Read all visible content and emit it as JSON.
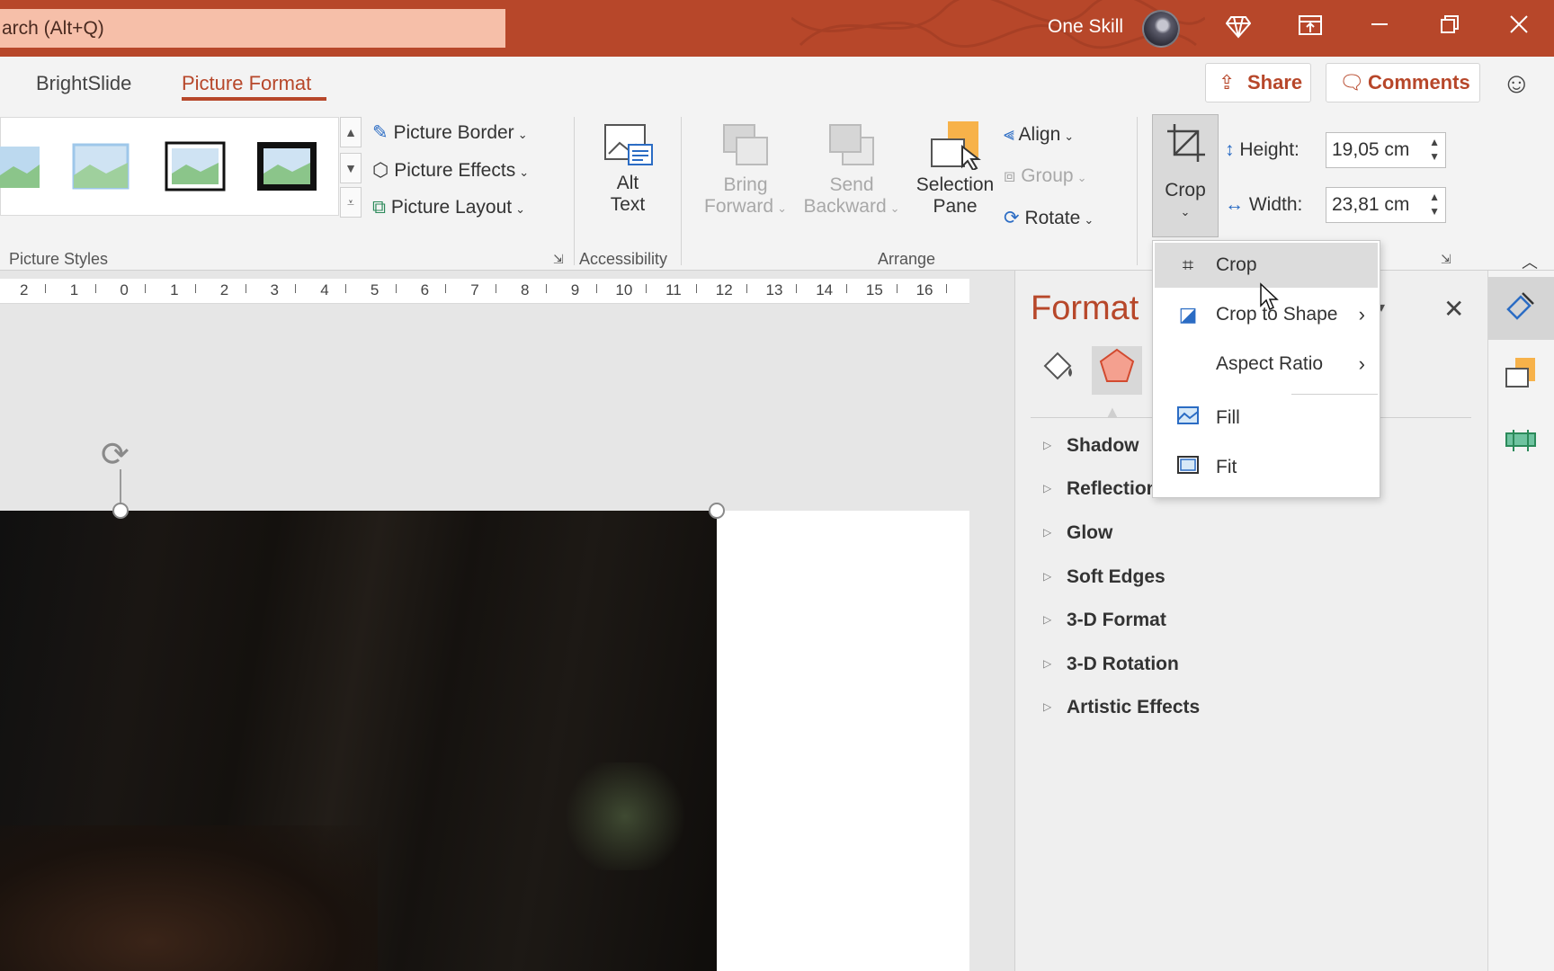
{
  "titlebar": {
    "search_text": "arch (Alt+Q)",
    "user_name": "One Skill",
    "accent": "#b7472a"
  },
  "tabs": {
    "brightslide": "BrightSlide",
    "picture_format": "Picture Format"
  },
  "actions": {
    "share": "Share",
    "comments": "Comments"
  },
  "ribbon": {
    "picture_styles": {
      "border": "Picture Border",
      "effects": "Picture Effects",
      "layout": "Picture Layout",
      "label": "Picture Styles"
    },
    "accessibility": {
      "alt_text_line1": "Alt",
      "alt_text_line2": "Text",
      "label": "Accessibility"
    },
    "arrange": {
      "bring_line1": "Bring",
      "bring_line2": "Forward",
      "send_line1": "Send",
      "send_line2": "Backward",
      "selection_line1": "Selection",
      "selection_line2": "Pane",
      "align": "Align",
      "group": "Group",
      "rotate": "Rotate",
      "label": "Arrange"
    },
    "size": {
      "crop": "Crop",
      "height_label": "Height:",
      "height_value": "19,05 cm",
      "width_label": "Width:",
      "width_value": "23,81 cm"
    }
  },
  "ruler": [
    "2",
    "1",
    "0",
    "1",
    "2",
    "3",
    "4",
    "5",
    "6",
    "7",
    "8",
    "9",
    "10",
    "11",
    "12",
    "13",
    "14",
    "15",
    "16"
  ],
  "crop_menu": {
    "items": [
      {
        "label": "Crop",
        "icon": "crop-icon"
      },
      {
        "label": "Crop to Shape",
        "icon": "crop-shape-icon"
      },
      {
        "label": "Aspect Ratio",
        "icon": ""
      },
      {
        "label": "Fill",
        "icon": "fill-image-icon"
      },
      {
        "label": "Fit",
        "icon": "fit-image-icon"
      }
    ]
  },
  "format_pane": {
    "title": "Format",
    "sections": [
      "Shadow",
      "Reflection",
      "Glow",
      "Soft Edges",
      "3-D Format",
      "3-D Rotation",
      "Artistic Effects"
    ]
  }
}
